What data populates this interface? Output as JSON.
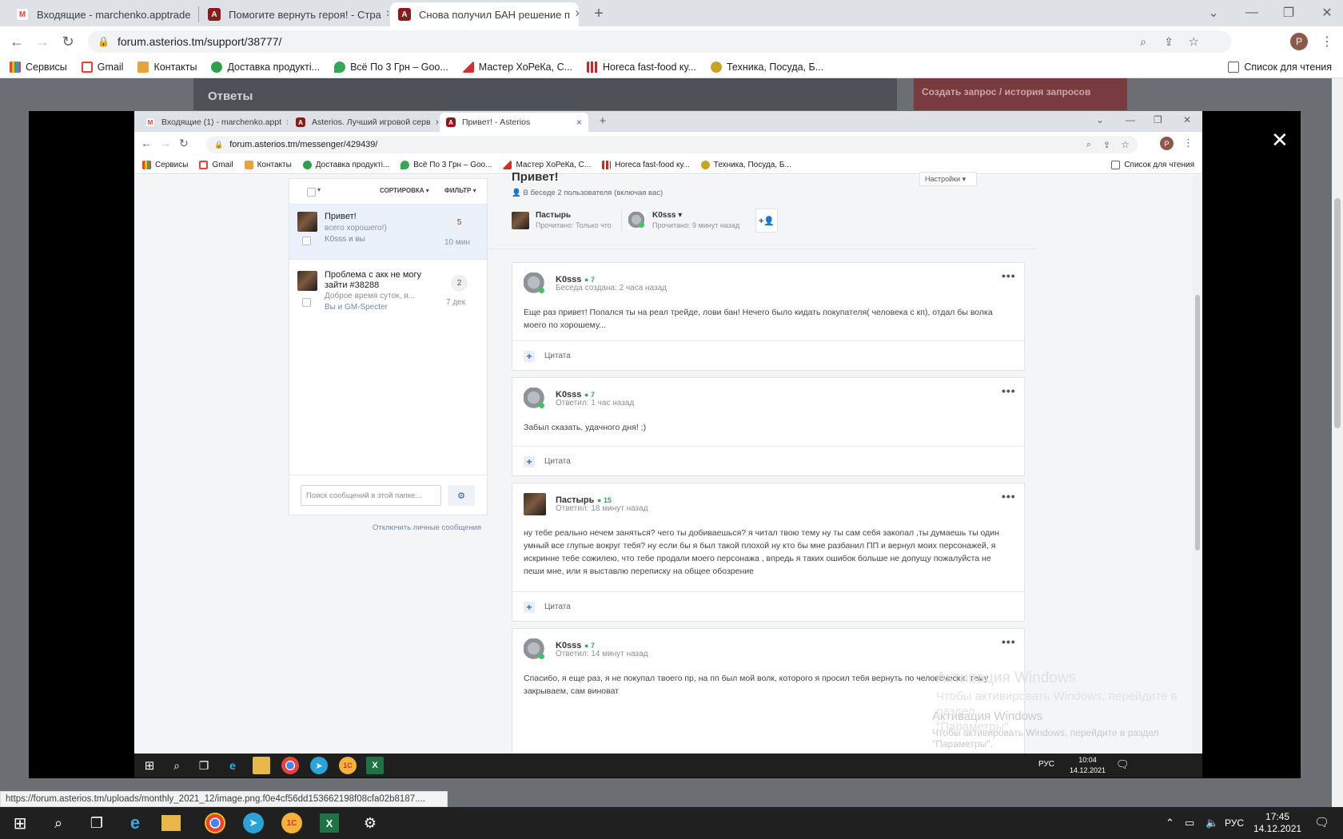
{
  "outer_browser": {
    "tabs": [
      {
        "label": "Входящие - marchenko.apptrade",
        "icon": "gmail-icon"
      },
      {
        "label": "Помогите вернуть героя! - Стра",
        "icon": "asterios-icon"
      },
      {
        "label": "Снова получил БАН решение п",
        "icon": "asterios-icon"
      }
    ],
    "url": "forum.asterios.tm/support/38777/",
    "profile_letter": "P",
    "bookmarks": [
      "Сервисы",
      "Gmail",
      "Контакты",
      "Доставка продукті...",
      "Всё По 3 Грн – Goo...",
      "Мастер ХоРеКа, С...",
      "Horeca fast-food ку...",
      "Техника, Посуда, Б..."
    ],
    "reading_list": "Список для чтения"
  },
  "page_behind": {
    "answers_heading": "Ответы",
    "red_button": "Создать запрос / история запросов"
  },
  "lightbox": {
    "close": "✕"
  },
  "inner_browser": {
    "tabs": [
      {
        "label": "Входящие (1) - marchenko.appt",
        "icon": "gmail-icon"
      },
      {
        "label": "Asterios. Лучший игровой серв",
        "icon": "asterios-icon"
      },
      {
        "label": "Привет! - Asterios",
        "icon": "asterios-icon"
      }
    ],
    "url": "forum.asterios.tm/messenger/429439/",
    "profile_letter": "P",
    "bookmarks": [
      "Сервисы",
      "Gmail",
      "Контакты",
      "Доставка продукті...",
      "Всё По 3 Грн – Goo...",
      "Мастер ХоРеКа, С...",
      "Horeca fast-food ку...",
      "Техника, Посуда, Б..."
    ],
    "reading_list": "Список для чтения"
  },
  "messenger": {
    "list_controls": {
      "sort": "СОРТИРОВКА",
      "filter": "ФИЛЬТР"
    },
    "conversations": [
      {
        "title": "Привет!",
        "preview": "всего хорошего!)",
        "participants": "K0sss и вы",
        "count": "5",
        "time": "10 мин"
      },
      {
        "title": "Проблема с акк не могу зайти #38288",
        "preview": "Доброе время суток, я...",
        "participants": "Вы и GM-Specter",
        "count": "2",
        "time": "7 дек"
      }
    ],
    "search_placeholder": "Поиск сообщений в этой папке...",
    "disable_pm": "Отключить личные сообщения",
    "thread": {
      "title": "Привет!",
      "settings": "Настройки",
      "info": "В беседе 2 пользователя (включая вас)",
      "participants": [
        {
          "name": "Пастырь",
          "status": "Прочитано: Только что"
        },
        {
          "name": "K0sss",
          "status": "Прочитано: 9 минут назад"
        }
      ]
    },
    "messages": [
      {
        "author": "K0sss",
        "rep": "7",
        "meta": "Беседа создана: 2 часа назад",
        "text": "Еще раз привет! Попался ты на реал трейде, лови бан! Нечего было кидать покупателя( человека с кп), отдал бы волка моего по хорошему...",
        "quote": "Цитата"
      },
      {
        "author": "K0sss",
        "rep": "7",
        "meta": "Ответил: 1 час назад",
        "text": "Забыл сказать, удачного дня! ;)",
        "quote": "Цитата"
      },
      {
        "author": "Пастырь",
        "rep": "15",
        "meta": "Ответил: 18 минут назад",
        "text": "ну тебе реально нечем заняться? чего ты добиваешься? я читал твою тему ну ты сам себя закопал ,ты думаешь ты один умный все глупые вокруг тебя? ну если бы я был такой плохой ну кто бы мне разбанил ПП и вернул моих персонажей, я искринне тебе сожилею, что тебе продали моего персонажа , впредь я таких ошибок больше не допущу пожалуйста не пеши мне, или я выставлю переписку на общее обозрение",
        "quote": "Цитата"
      },
      {
        "author": "K0sss",
        "rep": "7",
        "meta": "Ответил: 14 минут назад",
        "text": "Спасибо, я еще раз, я не покупал твоего пр, на пп был мой волк, которого я просил тебя вернуть по человечески, тему закрываем, сам виноват",
        "quote": ""
      }
    ]
  },
  "inner_taskbar": {
    "lang": "РУС",
    "time": "10:04",
    "date": "14.12.2021"
  },
  "watermark": {
    "title": "Активация Windows",
    "text": "Чтобы активировать Windows, перейдите в раздел",
    "text2": "\"Параметры\"."
  },
  "status_url": "https://forum.asterios.tm/uploads/monthly_2021_12/image.png.f0e4cf56dd153662198f08cfa02b8187....",
  "outer_taskbar": {
    "lang": "РУС",
    "time": "17:45",
    "date": "14.12.2021"
  }
}
